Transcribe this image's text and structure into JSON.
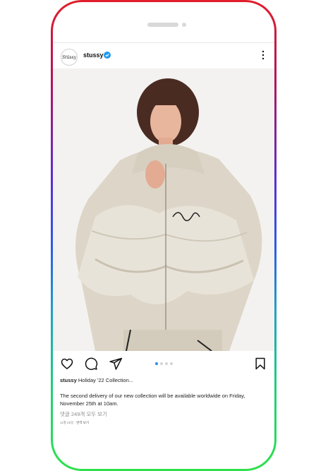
{
  "post": {
    "username": "stussy",
    "avatar_text": "Stüssy",
    "caption_username": "stussy",
    "caption_preview": "Holiday '22 Collection...",
    "description": "The second delivery of our new collection will be available worldwide on Friday, November 25th at 10am.",
    "comments_link": "댓글 249개 모두 보기",
    "date": "11월 25일",
    "translate": "번역 보기",
    "carousel": {
      "total": 4,
      "current": 1
    }
  },
  "colors": {
    "accent": "#2f8cf0",
    "verified": "#1d9bf0"
  },
  "icons": [
    "verified-badge-icon",
    "more-options-icon",
    "heart-icon",
    "comment-icon",
    "share-icon",
    "bookmark-icon"
  ]
}
